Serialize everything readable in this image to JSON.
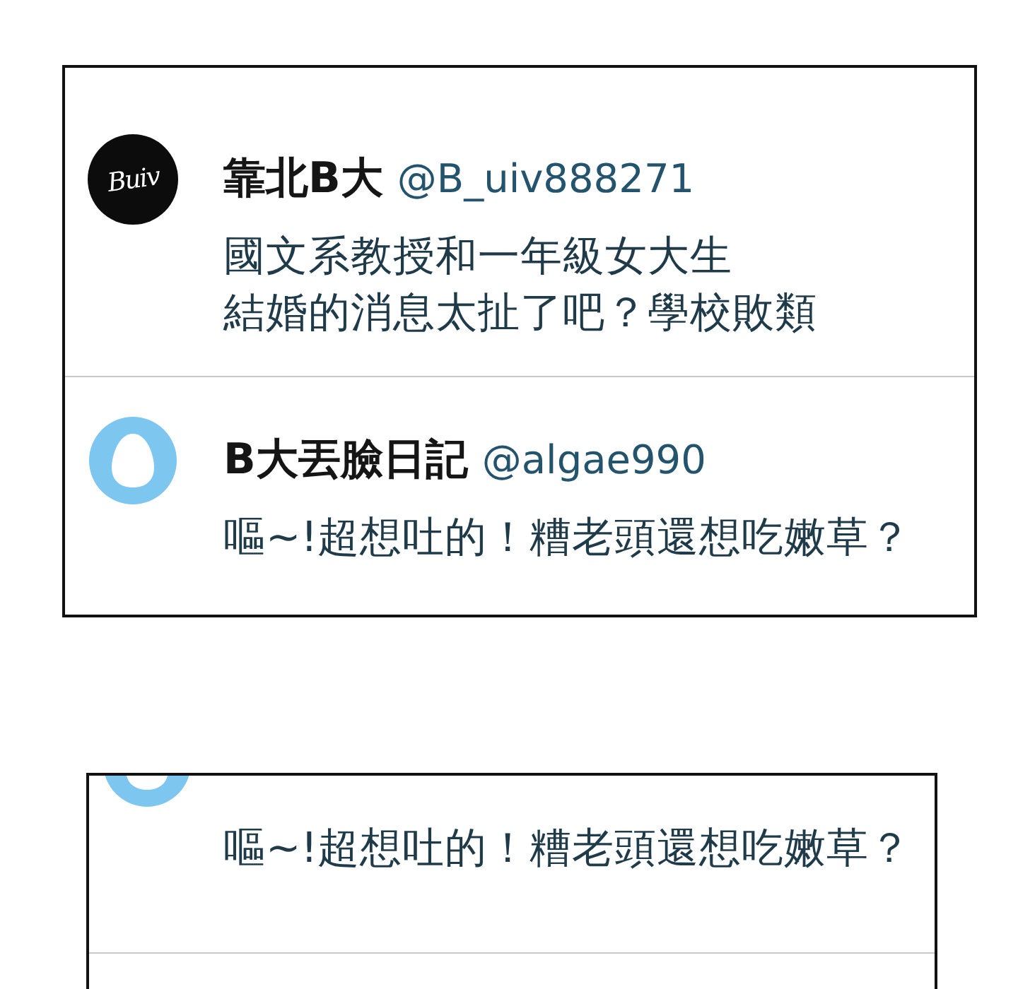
{
  "panels": [
    {
      "top_cut": false,
      "bottom_cut": false,
      "posts": [
        {
          "avatar": {
            "kind": "logo",
            "text": "Buiv"
          },
          "name": "靠北B大",
          "handle": "@B_uiv888271",
          "text_lines": [
            "國文系教授和一年級女大生",
            "結婚的消息太扯了吧？學校敗類"
          ]
        },
        {
          "avatar": {
            "kind": "egg"
          },
          "name": "B大丟臉日記",
          "handle": "@algae990",
          "text_lines": [
            "嘔~!超想吐的！糟老頭還想吃嫩草？"
          ]
        }
      ]
    },
    {
      "top_cut": true,
      "bottom_cut": true,
      "posts": [
        {
          "avatar": {
            "kind": "egg"
          },
          "text_lines": [
            "嘔~!超想吐的！糟老頭還想吃嫩草？"
          ]
        }
      ]
    }
  ]
}
